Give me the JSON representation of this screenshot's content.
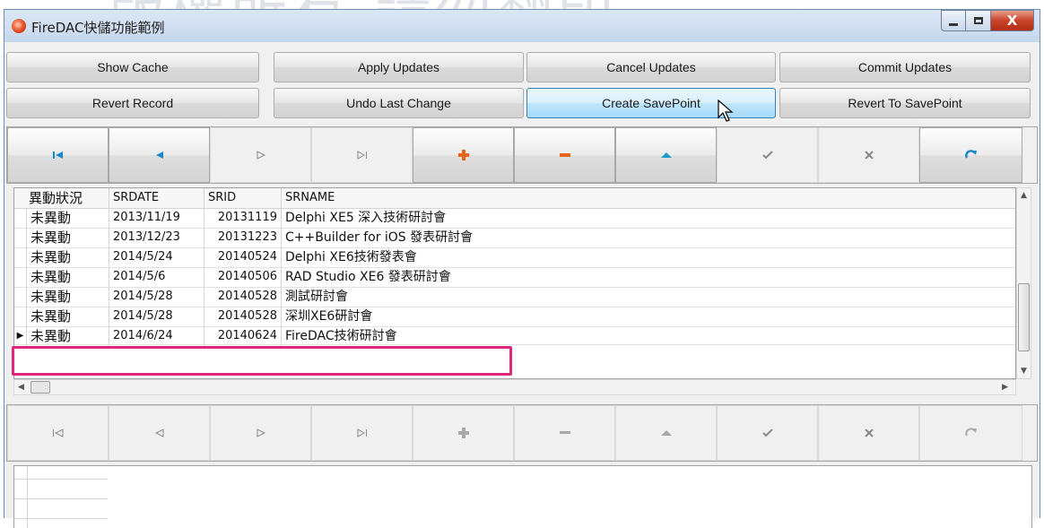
{
  "window": {
    "title": "FireDAC快儲功能範例",
    "background_text": "版權所有 請勿翻印",
    "minimize_label": "",
    "close_label": "X"
  },
  "buttons_row1": [
    "Show Cache",
    "Apply Updates",
    "Cancel Updates",
    "Commit Updates"
  ],
  "buttons_row2": [
    "Revert Record",
    "Undo Last Change",
    "Create SavePoint",
    "Revert To SavePoint"
  ],
  "navigator_icons": [
    "first-icon",
    "prior-icon",
    "next-icon",
    "last-icon",
    "insert-icon",
    "delete-icon",
    "edit-icon",
    "post-icon",
    "cancel-icon",
    "refresh-icon"
  ],
  "grid": {
    "columns": [
      "異動狀況",
      "SRDATE",
      "SRID",
      "SRNAME"
    ],
    "rows": [
      {
        "status": "未異動",
        "date": "2013/11/19",
        "id": "20131119",
        "name": "Delphi XE5 深入技術研討會"
      },
      {
        "status": "未異動",
        "date": "2013/12/23",
        "id": "20131223",
        "name": "C++Builder for iOS 發表研討會"
      },
      {
        "status": "未異動",
        "date": "2014/5/24",
        "id": "20140524",
        "name": "Delphi XE6技術發表會"
      },
      {
        "status": "未異動",
        "date": "2014/5/6",
        "id": "20140506",
        "name": "RAD Studio XE6 發表研討會"
      },
      {
        "status": "未異動",
        "date": "2014/5/28",
        "id": "20140528",
        "name": "測試研討會"
      },
      {
        "status": "未異動",
        "date": "2014/5/28",
        "id": "20140528",
        "name": "深圳XE6研討會"
      },
      {
        "status": "未異動",
        "date": "2014/6/24",
        "id": "20140624",
        "name": "FireDAC技術研討會"
      }
    ],
    "current_row_indicator": "▶"
  },
  "colors": {
    "highlight": "#e0287a",
    "hot_button": "#bee6fd",
    "insert": "#e8641c",
    "delete": "#e8641c",
    "edit": "#1c9cc8",
    "refresh": "#1c88c8"
  }
}
